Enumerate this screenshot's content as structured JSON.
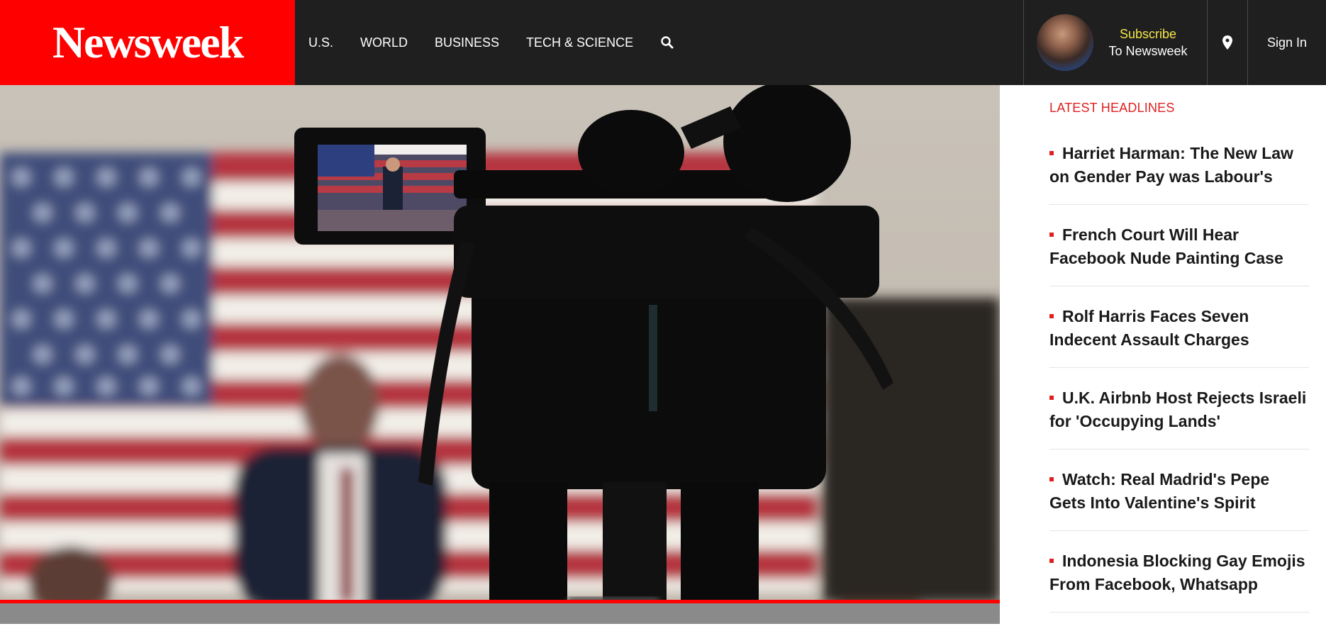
{
  "header": {
    "logo": "Newsweek",
    "nav": [
      "U.S.",
      "WORLD",
      "BUSINESS",
      "TECH & SCIENCE"
    ],
    "search_icon": "search-icon",
    "subscribe_line1": "Subscribe",
    "subscribe_line2": "To Newsweek",
    "location_icon": "map-pin-icon",
    "signin": "Sign In"
  },
  "colors": {
    "brand_red": "#ff0000",
    "header_bg": "#1f1f1f",
    "subscribe_yellow": "#f5e64a",
    "headline_label_red": "#e02020"
  },
  "sidebar": {
    "title": "LATEST HEADLINES",
    "headlines": [
      "Harriet Harman: The New Law on Gender Pay was Labour's",
      "French Court Will Hear Facebook Nude Painting Case",
      "Rolf Harris Faces Seven Indecent Assault Charges",
      "U.K. Airbnb Host Rejects Israeli for 'Occupying Lands'",
      "Watch: Real Madrid's Pepe Gets Into Valentine's Spirit",
      "Indonesia Blocking Gay Emojis From Facebook, Whatsapp"
    ]
  }
}
